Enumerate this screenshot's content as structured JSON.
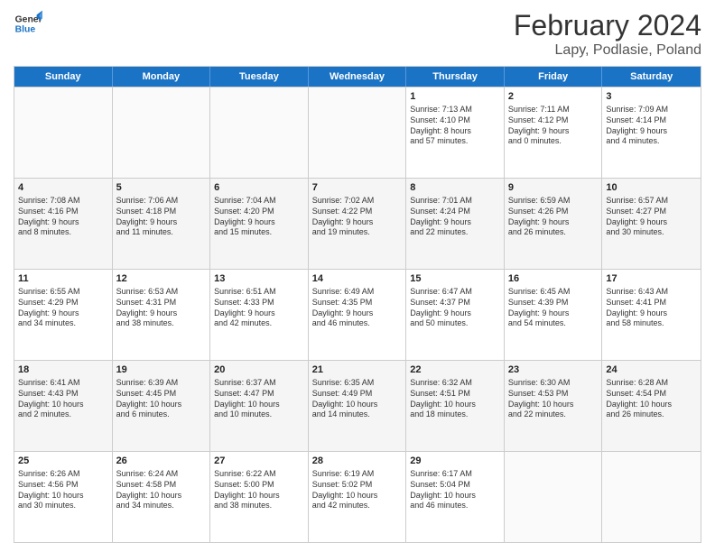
{
  "header": {
    "logo_line1": "General",
    "logo_line2": "Blue",
    "title": "February 2024",
    "subtitle": "Lapy, Podlasie, Poland"
  },
  "weekdays": [
    "Sunday",
    "Monday",
    "Tuesday",
    "Wednesday",
    "Thursday",
    "Friday",
    "Saturday"
  ],
  "rows": [
    [
      {
        "day": "",
        "info": "",
        "empty": true
      },
      {
        "day": "",
        "info": "",
        "empty": true
      },
      {
        "day": "",
        "info": "",
        "empty": true
      },
      {
        "day": "",
        "info": "",
        "empty": true
      },
      {
        "day": "1",
        "info": "Sunrise: 7:13 AM\nSunset: 4:10 PM\nDaylight: 8 hours\nand 57 minutes."
      },
      {
        "day": "2",
        "info": "Sunrise: 7:11 AM\nSunset: 4:12 PM\nDaylight: 9 hours\nand 0 minutes."
      },
      {
        "day": "3",
        "info": "Sunrise: 7:09 AM\nSunset: 4:14 PM\nDaylight: 9 hours\nand 4 minutes."
      }
    ],
    [
      {
        "day": "4",
        "info": "Sunrise: 7:08 AM\nSunset: 4:16 PM\nDaylight: 9 hours\nand 8 minutes."
      },
      {
        "day": "5",
        "info": "Sunrise: 7:06 AM\nSunset: 4:18 PM\nDaylight: 9 hours\nand 11 minutes."
      },
      {
        "day": "6",
        "info": "Sunrise: 7:04 AM\nSunset: 4:20 PM\nDaylight: 9 hours\nand 15 minutes."
      },
      {
        "day": "7",
        "info": "Sunrise: 7:02 AM\nSunset: 4:22 PM\nDaylight: 9 hours\nand 19 minutes."
      },
      {
        "day": "8",
        "info": "Sunrise: 7:01 AM\nSunset: 4:24 PM\nDaylight: 9 hours\nand 22 minutes."
      },
      {
        "day": "9",
        "info": "Sunrise: 6:59 AM\nSunset: 4:26 PM\nDaylight: 9 hours\nand 26 minutes."
      },
      {
        "day": "10",
        "info": "Sunrise: 6:57 AM\nSunset: 4:27 PM\nDaylight: 9 hours\nand 30 minutes."
      }
    ],
    [
      {
        "day": "11",
        "info": "Sunrise: 6:55 AM\nSunset: 4:29 PM\nDaylight: 9 hours\nand 34 minutes."
      },
      {
        "day": "12",
        "info": "Sunrise: 6:53 AM\nSunset: 4:31 PM\nDaylight: 9 hours\nand 38 minutes."
      },
      {
        "day": "13",
        "info": "Sunrise: 6:51 AM\nSunset: 4:33 PM\nDaylight: 9 hours\nand 42 minutes."
      },
      {
        "day": "14",
        "info": "Sunrise: 6:49 AM\nSunset: 4:35 PM\nDaylight: 9 hours\nand 46 minutes."
      },
      {
        "day": "15",
        "info": "Sunrise: 6:47 AM\nSunset: 4:37 PM\nDaylight: 9 hours\nand 50 minutes."
      },
      {
        "day": "16",
        "info": "Sunrise: 6:45 AM\nSunset: 4:39 PM\nDaylight: 9 hours\nand 54 minutes."
      },
      {
        "day": "17",
        "info": "Sunrise: 6:43 AM\nSunset: 4:41 PM\nDaylight: 9 hours\nand 58 minutes."
      }
    ],
    [
      {
        "day": "18",
        "info": "Sunrise: 6:41 AM\nSunset: 4:43 PM\nDaylight: 10 hours\nand 2 minutes."
      },
      {
        "day": "19",
        "info": "Sunrise: 6:39 AM\nSunset: 4:45 PM\nDaylight: 10 hours\nand 6 minutes."
      },
      {
        "day": "20",
        "info": "Sunrise: 6:37 AM\nSunset: 4:47 PM\nDaylight: 10 hours\nand 10 minutes."
      },
      {
        "day": "21",
        "info": "Sunrise: 6:35 AM\nSunset: 4:49 PM\nDaylight: 10 hours\nand 14 minutes."
      },
      {
        "day": "22",
        "info": "Sunrise: 6:32 AM\nSunset: 4:51 PM\nDaylight: 10 hours\nand 18 minutes."
      },
      {
        "day": "23",
        "info": "Sunrise: 6:30 AM\nSunset: 4:53 PM\nDaylight: 10 hours\nand 22 minutes."
      },
      {
        "day": "24",
        "info": "Sunrise: 6:28 AM\nSunset: 4:54 PM\nDaylight: 10 hours\nand 26 minutes."
      }
    ],
    [
      {
        "day": "25",
        "info": "Sunrise: 6:26 AM\nSunset: 4:56 PM\nDaylight: 10 hours\nand 30 minutes."
      },
      {
        "day": "26",
        "info": "Sunrise: 6:24 AM\nSunset: 4:58 PM\nDaylight: 10 hours\nand 34 minutes."
      },
      {
        "day": "27",
        "info": "Sunrise: 6:22 AM\nSunset: 5:00 PM\nDaylight: 10 hours\nand 38 minutes."
      },
      {
        "day": "28",
        "info": "Sunrise: 6:19 AM\nSunset: 5:02 PM\nDaylight: 10 hours\nand 42 minutes."
      },
      {
        "day": "29",
        "info": "Sunrise: 6:17 AM\nSunset: 5:04 PM\nDaylight: 10 hours\nand 46 minutes."
      },
      {
        "day": "",
        "info": "",
        "empty": true
      },
      {
        "day": "",
        "info": "",
        "empty": true
      }
    ]
  ]
}
